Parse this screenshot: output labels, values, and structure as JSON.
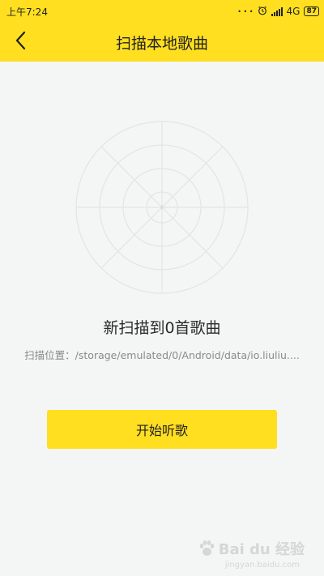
{
  "status_bar": {
    "time": "上午7:24",
    "dots": "• • •",
    "network": "4G",
    "battery": "87",
    "icons": [
      "dots-icon",
      "alarm-icon",
      "signal-icon",
      "battery-icon"
    ]
  },
  "nav": {
    "back_icon": "chevron-left-icon",
    "title": "扫描本地歌曲"
  },
  "scan": {
    "result_text": "新扫描到0首歌曲",
    "location_text": "扫描位置：/storage/emulated/0/Android/data/io.liuliu...."
  },
  "actions": {
    "start_label": "开始听歌"
  },
  "watermark": {
    "logo_text": "Bai du 经验",
    "url": "jingyan.baidu.com"
  },
  "colors": {
    "accent": "#ffdf1f",
    "background": "#f4f5f5",
    "radar_line": "#e4e4e4"
  }
}
